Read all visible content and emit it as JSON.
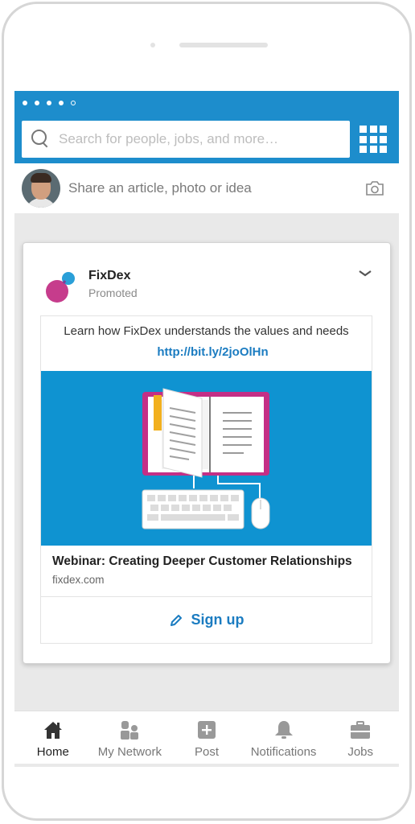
{
  "header": {
    "search_placeholder": "Search for people, jobs, and more…",
    "accent_color": "#1d8dcc"
  },
  "share": {
    "prompt": "Share an article, photo or idea"
  },
  "post": {
    "company": "FixDex",
    "label": "Promoted",
    "body": "Learn how FixDex understands the values and needs",
    "link": "http://bit.ly/2joOlHn",
    "headline": "Webinar: Creating Deeper Customer Relationships",
    "domain": "fixdex.com",
    "cta": "Sign up"
  },
  "nav": {
    "items": [
      {
        "label": "Home",
        "icon": "home-icon",
        "active": true
      },
      {
        "label": "My Network",
        "icon": "network-icon",
        "active": false
      },
      {
        "label": "Post",
        "icon": "post-icon",
        "active": false
      },
      {
        "label": "Notifications",
        "icon": "bell-icon",
        "active": false
      },
      {
        "label": "Jobs",
        "icon": "briefcase-icon",
        "active": false
      }
    ]
  }
}
